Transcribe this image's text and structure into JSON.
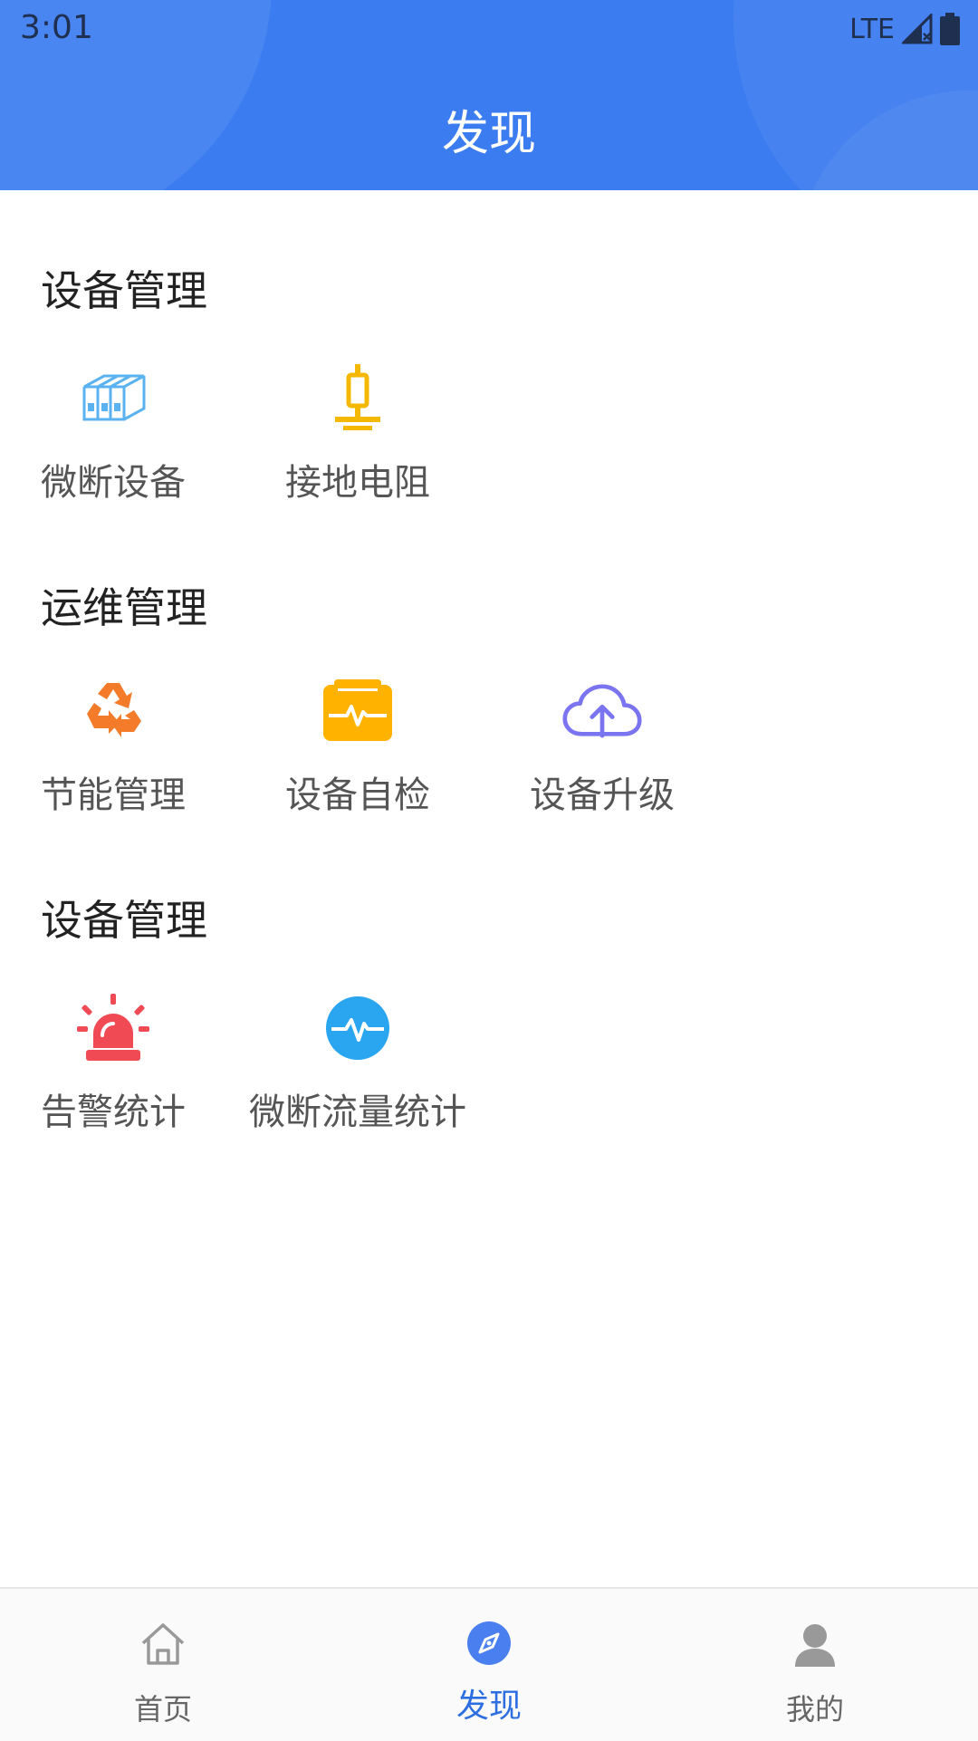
{
  "status_bar": {
    "time": "3:01",
    "network": "LTE"
  },
  "header": {
    "title": "发现"
  },
  "sections": [
    {
      "title": "设备管理",
      "items": [
        {
          "label": "微断设备",
          "icon": "circuit-breaker-icon"
        },
        {
          "label": "接地电阻",
          "icon": "grounding-resistor-icon"
        }
      ]
    },
    {
      "title": "运维管理",
      "items": [
        {
          "label": "节能管理",
          "icon": "recycle-icon"
        },
        {
          "label": "设备自检",
          "icon": "self-check-icon"
        },
        {
          "label": "设备升级",
          "icon": "cloud-upload-icon"
        }
      ]
    },
    {
      "title": "设备管理",
      "items": [
        {
          "label": "告警统计",
          "icon": "alarm-siren-icon"
        },
        {
          "label": "微断流量统计",
          "icon": "pulse-icon"
        }
      ]
    }
  ],
  "bottom_nav": [
    {
      "label": "首页",
      "icon": "home-icon",
      "active": false
    },
    {
      "label": "发现",
      "icon": "compass-icon",
      "active": true
    },
    {
      "label": "我的",
      "icon": "user-icon",
      "active": false
    }
  ],
  "colors": {
    "header": "#3b7cf0",
    "breaker": "#5ab3f0",
    "grounding": "#f5b800",
    "recycle": "#f37b2a",
    "self_check": "#ffb300",
    "cloud": "#7b74f0",
    "alarm": "#f04b55",
    "pulse": "#2aa6f0",
    "nav_active": "#2d6fe0"
  }
}
